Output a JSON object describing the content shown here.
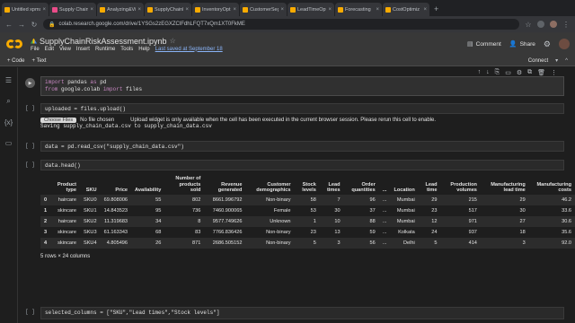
{
  "browser": {
    "tabs": [
      {
        "label": "Untitled xpms",
        "color": "#f9ab00"
      },
      {
        "label": "Supply Chain",
        "color": "#ea4c89"
      },
      {
        "label": "Analyzing&Vis",
        "color": "#f9ab00"
      },
      {
        "label": "SupplyChainR",
        "color": "#f9ab00",
        "active": true
      },
      {
        "label": "InventoryOpt",
        "color": "#f9ab00"
      },
      {
        "label": "CustomerSeg",
        "color": "#f9ab00"
      },
      {
        "label": "LeadTimeOpt",
        "color": "#f9ab00"
      },
      {
        "label": "Forecasting",
        "color": "#f9ab00"
      },
      {
        "label": "CostOptimiz",
        "color": "#f9ab00"
      }
    ],
    "new_tab": "+",
    "url": "colab.research.google.com/drive/1YSGs2zEGXZClFdhLFQT7xQm1XT0FkME"
  },
  "colab": {
    "notebook_name": "SupplyChainRiskAssessment.ipynb",
    "menu": [
      "File",
      "Edit",
      "View",
      "Insert",
      "Runtime",
      "Tools",
      "Help"
    ],
    "saved_status": "Last saved at September 18",
    "comment_label": "Comment",
    "share_label": "Share"
  },
  "toolbar": {
    "code_label": "+ Code",
    "text_label": "+ Text",
    "connect_label": "Connect"
  },
  "cells": {
    "c1": [
      "import pandas as pd",
      "from google.colab import files"
    ],
    "c2": "uploaded = files.upload()",
    "c2_bracket": "[ ]",
    "upload_button": "Choose Files",
    "upload_nofile": "No file chosen",
    "upload_warning": "Upload widget is only available when the cell has been executed in the current browser session. Please rerun this cell to enable.",
    "upload_saving": "Saving supply_chain_data.csv to supply_chain_data.csv",
    "c3": "data = pd.read_csv(\"supply_chain_data.csv\")",
    "c4": "data.head()",
    "c5": "selected_columns = [\"SKU\",\"Lead times\",\"Stock levels\"]"
  },
  "table": {
    "headers": [
      "",
      "Product type",
      "SKU",
      "Price",
      "Availability",
      "Number of products sold",
      "Revenue generated",
      "Customer demographics",
      "Stock levels",
      "Lead times",
      "Order quantities",
      "...",
      "Location",
      "Lead time",
      "Production volumes",
      "Manufacturing lead time",
      "Manufacturing costs"
    ],
    "rows": [
      [
        "0",
        "haircare",
        "SKU0",
        "69.808006",
        "55",
        "802",
        "8661.996792",
        "Non-binary",
        "58",
        "7",
        "96",
        "...",
        "Mumbai",
        "29",
        "215",
        "29",
        "46.2"
      ],
      [
        "1",
        "skincare",
        "SKU1",
        "14.843523",
        "95",
        "736",
        "7460.900065",
        "Female",
        "53",
        "30",
        "37",
        "...",
        "Mumbai",
        "23",
        "517",
        "30",
        "33.6"
      ],
      [
        "2",
        "haircare",
        "SKU2",
        "11.319683",
        "34",
        "8",
        "9577.749626",
        "Unknown",
        "1",
        "10",
        "88",
        "...",
        "Mumbai",
        "12",
        "971",
        "27",
        "30.6"
      ],
      [
        "3",
        "skincare",
        "SKU3",
        "61.163343",
        "68",
        "83",
        "7766.836426",
        "Non-binary",
        "23",
        "13",
        "59",
        "...",
        "Kolkata",
        "24",
        "937",
        "18",
        "35.6"
      ],
      [
        "4",
        "skincare",
        "SKU4",
        "4.805496",
        "26",
        "871",
        "2686.505152",
        "Non-binary",
        "5",
        "3",
        "56",
        "...",
        "Delhi",
        "5",
        "414",
        "3",
        "92.0"
      ]
    ],
    "shape": "5 rows × 24 columns"
  }
}
